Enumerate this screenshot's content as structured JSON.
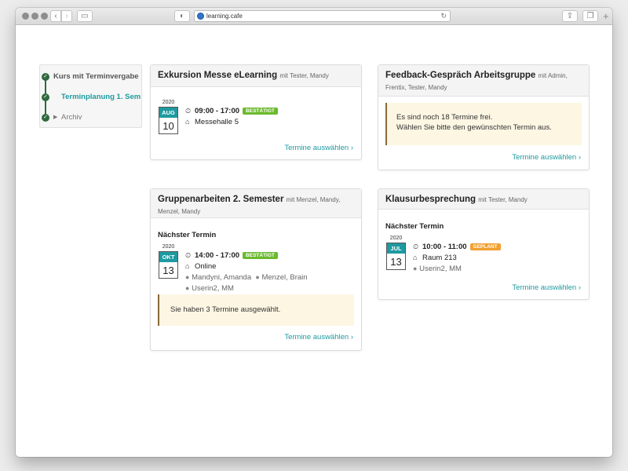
{
  "browser": {
    "url": "learning.cafe"
  },
  "nav": {
    "items": [
      {
        "label": "Kurs mit Terminvergabe"
      },
      {
        "label": "Terminplanung 1. Sem"
      },
      {
        "label": "Archiv"
      }
    ]
  },
  "cards": {
    "exkursion": {
      "title": "Exkursion Messe eLearning",
      "with": "mit Tester, Mandy",
      "year": "2020",
      "month": "AUG",
      "day": "10",
      "time": "09:00 - 17:00",
      "status": "BESTÄTIGT",
      "location": "Messehalle 5",
      "link": "Termine auswählen"
    },
    "feedback": {
      "title": "Feedback-Gespräch Arbeitsgruppe",
      "with": "mit Admin, Frentix, Tester, Mandy",
      "notice_line1": "Es sind noch 18 Termine frei.",
      "notice_line2": "Wählen Sie bitte den gewünschten Termin aus.",
      "link": "Termine auswählen"
    },
    "gruppen": {
      "title": "Gruppenarbeiten 2. Semester",
      "with": "mit Menzel, Mandy, Menzel, Mandy",
      "next_label": "Nächster Termin",
      "year": "2020",
      "month": "OKT",
      "day": "13",
      "time": "14:00 - 17:00",
      "status": "BESTÄTIGT",
      "location": "Online",
      "participants": [
        "Mandyni, Amanda",
        "Menzel, Brain",
        "Userin2, MM"
      ],
      "notice": "Sie haben 3 Termine ausgewählt.",
      "link": "Termine auswählen"
    },
    "klausur": {
      "title": "Klausurbesprechung",
      "with": "mit Tester, Mandy",
      "next_label": "Nächster Termin",
      "year": "2020",
      "month": "JUL",
      "day": "13",
      "time": "10:00 - 11:00",
      "status": "GEPLANT",
      "location": "Raum 213",
      "participants": [
        "Userin2, MM"
      ],
      "link": "Termine auswählen"
    }
  },
  "colors": {
    "accent": "#1e9aa0",
    "confirmed": "#6aba2c",
    "planned": "#f0a030",
    "nav_check": "#2e6a3d"
  },
  "icons": {
    "clock": "clock-icon",
    "home": "home-icon",
    "user": "user-icon",
    "check": "check-icon",
    "chevron": "chevron-right-icon"
  }
}
